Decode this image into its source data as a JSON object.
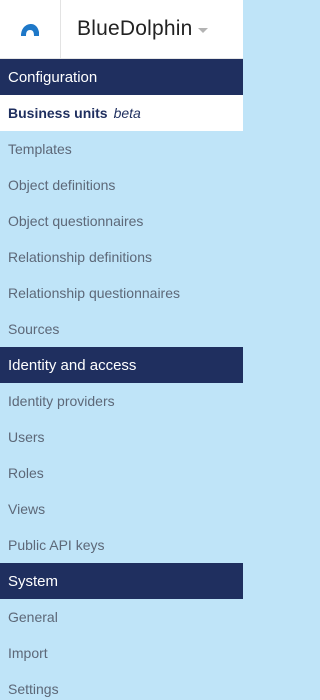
{
  "header": {
    "app_name": "BlueDolphin",
    "logo_icon": "dolphin-logo-icon"
  },
  "sections": [
    {
      "title": "Configuration",
      "items": [
        {
          "label": "Business units",
          "badge": "beta",
          "active": true
        },
        {
          "label": "Templates"
        },
        {
          "label": "Object definitions"
        },
        {
          "label": "Object questionnaires"
        },
        {
          "label": "Relationship definitions"
        },
        {
          "label": "Relationship questionnaires"
        },
        {
          "label": "Sources"
        }
      ]
    },
    {
      "title": "Identity and access",
      "items": [
        {
          "label": "Identity providers"
        },
        {
          "label": "Users"
        },
        {
          "label": "Roles"
        },
        {
          "label": "Views"
        },
        {
          "label": "Public API keys"
        }
      ]
    },
    {
      "title": "System",
      "items": [
        {
          "label": "General"
        },
        {
          "label": "Import"
        },
        {
          "label": "Settings"
        }
      ]
    }
  ],
  "colors": {
    "section_bg": "#1f2f5f",
    "menu_bg": "#bfe4f8",
    "active_bg": "#ffffff",
    "logo": "#1e78c8"
  }
}
